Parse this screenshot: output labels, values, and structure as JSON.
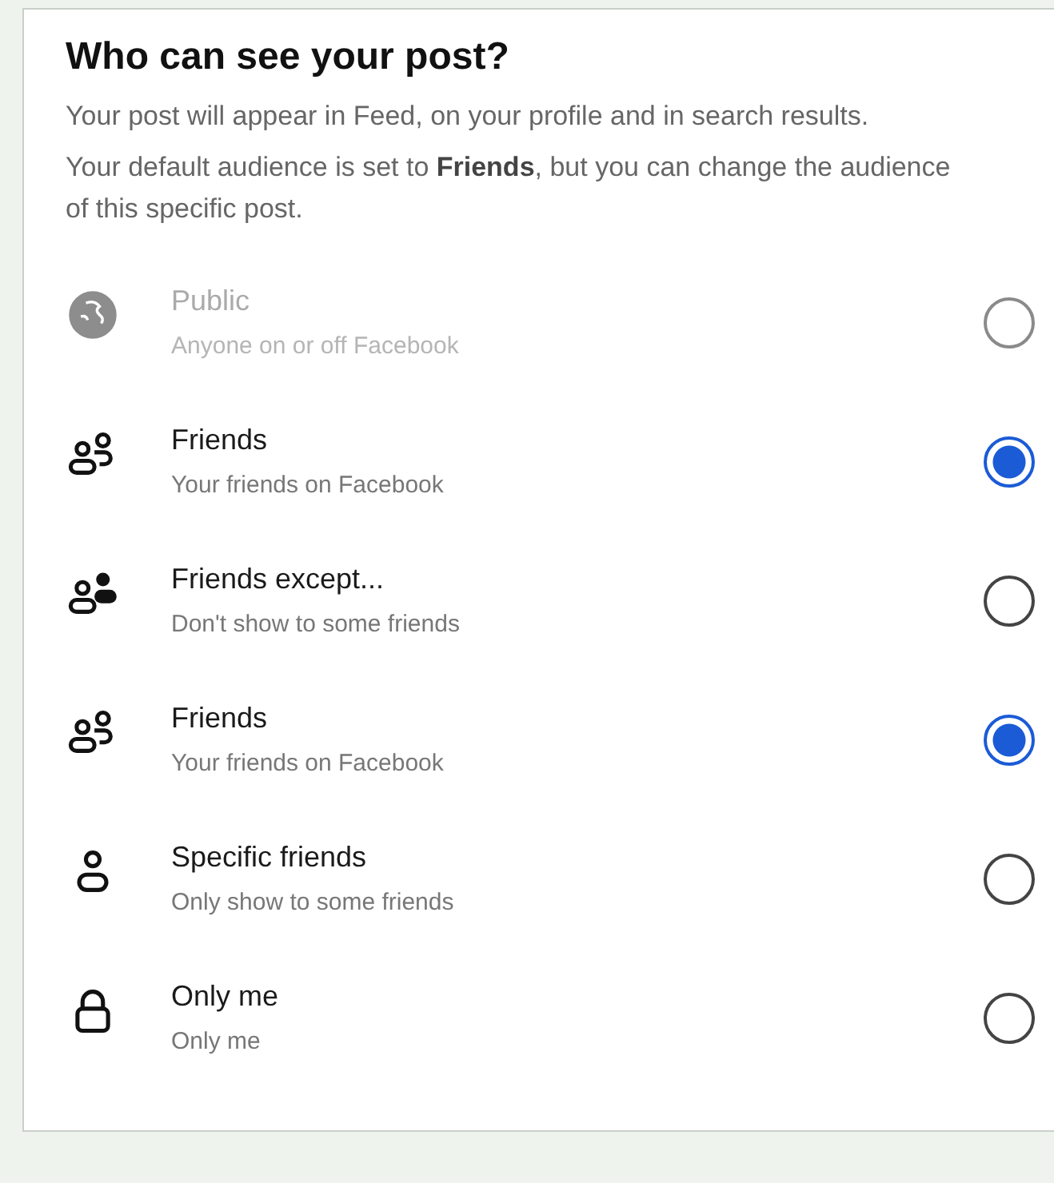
{
  "title": "Who can see your post?",
  "paragraphs": [
    "Your post will appear in Feed, on your profile and in search results.",
    "Your default audience is set to **Friends**, but you can change the audience of this specific post."
  ],
  "options": [
    {
      "kind": "globe",
      "label": "Public",
      "description": "Anyone on or off Facebook",
      "selected": false,
      "disabled": true
    },
    {
      "kind": "friends",
      "label": "Friends",
      "description": "Your friends on Facebook",
      "selected": true,
      "disabled": false
    },
    {
      "kind": "except",
      "label": "Friends except...",
      "description": "Don't show to some friends",
      "selected": false,
      "disabled": false
    },
    {
      "kind": "friends",
      "label": "Friends",
      "description": "Your friends on Facebook",
      "selected": true,
      "disabled": false
    },
    {
      "kind": "person",
      "label": "Specific friends",
      "description": "Only show to some friends",
      "selected": false,
      "disabled": false
    },
    {
      "kind": "lock",
      "label": "Only me",
      "description": "Only me",
      "selected": false,
      "disabled": false
    }
  ]
}
